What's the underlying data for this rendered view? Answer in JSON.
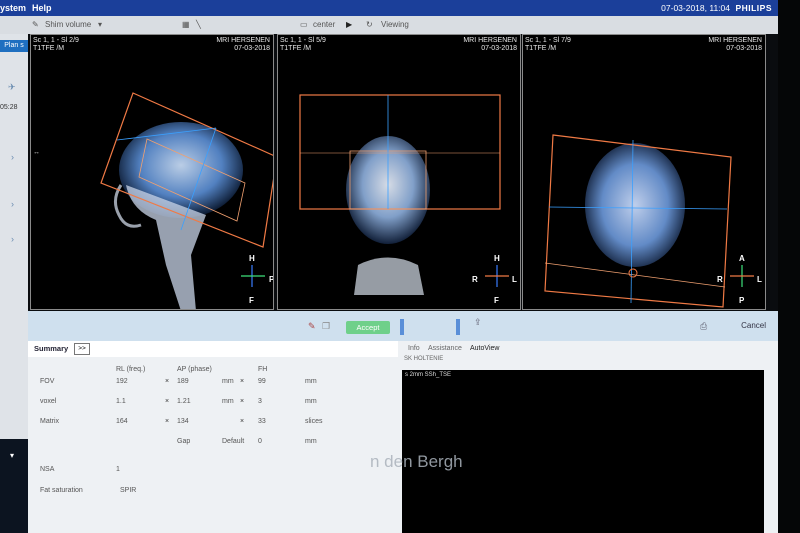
{
  "menubar": {
    "system": "ystem",
    "help": "Help",
    "date": "07-03-2018, 11:04",
    "brand": "PHILIPS"
  },
  "toolbar": {
    "shim": "Shim volume",
    "center": "center",
    "viewing": "Viewing"
  },
  "leftpanel": {
    "plan": "Plan s",
    "time": "05:28"
  },
  "viewports": [
    {
      "series": "Sc 1, 1 - Sl 2/9",
      "seq": "T1TFE   /M",
      "patient": "MRI HERSENEN",
      "date": "07-03-2018",
      "o_top": "H",
      "o_bottom": "F",
      "o_left": "",
      "o_right": "P"
    },
    {
      "series": "Sc 1, 1 - Sl 5/9",
      "seq": "T1TFE   /M",
      "patient": "MRI HERSENEN",
      "date": "07-03-2018",
      "o_top": "H",
      "o_bottom": "F",
      "o_left": "R",
      "o_right": "L"
    },
    {
      "series": "Sc 1, 1 - Sl 7/9",
      "seq": "T1TFE   /M",
      "patient": "MRI HERSENEN",
      "date": "07-03-2018",
      "o_top": "A",
      "o_bottom": "P",
      "o_left": "R",
      "o_right": "L"
    }
  ],
  "lower": {
    "accept": "Accept",
    "cancel": "Cancel",
    "summary": "Summary",
    "more": ">>",
    "col_rl": "RL (freq.)",
    "col_ap": "AP (phase)",
    "col_fh": "FH",
    "row_fov": "FOV",
    "row_voxel": "voxel",
    "row_matrix": "Matrix",
    "fov_rl": "192",
    "fov_ap": "189",
    "fov_fh": "99",
    "fov_unit": "mm",
    "vox_rl": "1.1",
    "vox_ap": "1.21",
    "vox_fh": "3",
    "vox_unit": "mm",
    "mat_rl": "164",
    "mat_ap": "134",
    "mat_fh": "33",
    "mat_unit": "slices",
    "gap": "Gap",
    "gap_default": "Default",
    "gap_val": "0",
    "gap_unit": "mm",
    "x": "×",
    "nsa": "NSA",
    "nsa_val": "1",
    "fat": "Fat saturation",
    "fat_val": "SPIR",
    "info": "Info",
    "assistance": "Assistance",
    "autoview": "AutoView",
    "sk": "SK HOLTENIE",
    "preview": "s 2mm SSh_TSE",
    "watermark": "n den Bergh"
  },
  "colors": {
    "menubar": "#1b3f9a",
    "planbox": "#e07a4a",
    "accept": "#6fd08a"
  }
}
